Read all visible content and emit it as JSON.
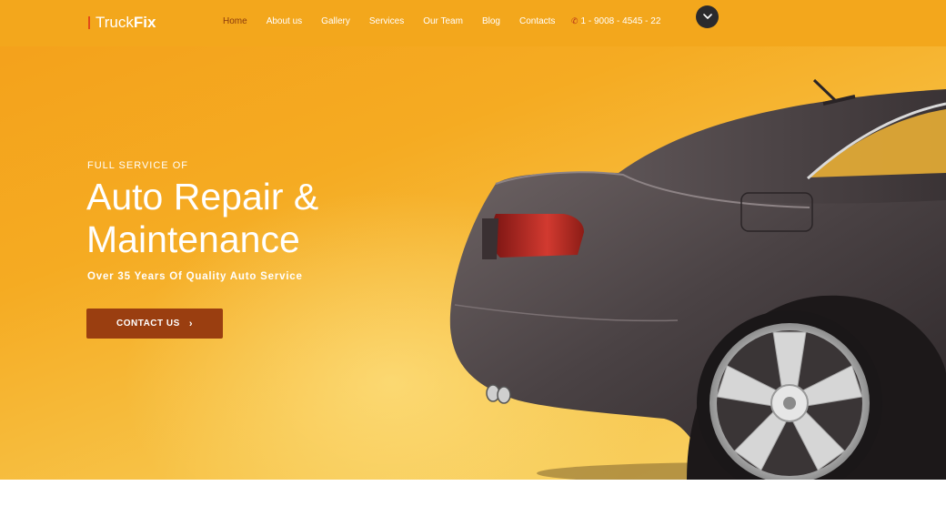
{
  "header": {
    "logo_light": "Truck",
    "logo_bold": "Fix",
    "nav": [
      {
        "label": "Home",
        "active": true
      },
      {
        "label": "About us"
      },
      {
        "label": "Gallery"
      },
      {
        "label": "Services"
      },
      {
        "label": "Our Team"
      },
      {
        "label": "Blog"
      },
      {
        "label": "Contacts"
      }
    ],
    "phone": "1 - 9008 - 4545 - 22",
    "phone_icon": "phone-icon",
    "menu_toggle_icon": "chevron-down-icon"
  },
  "hero": {
    "kicker": "FULL SERVICE OF",
    "headline_line1": "Auto Repair &",
    "headline_line2": "Maintenance",
    "subheading": "Over 35 Years Of Quality Auto Service",
    "cta_label": "CONTACT US",
    "cta_icon": "chevron-right-icon"
  },
  "colors": {
    "header_bg": "#f3a71c",
    "active_nav": "#8a3a0c",
    "cta_bg": "#9a3e10",
    "logo_accent": "#e24a18"
  }
}
